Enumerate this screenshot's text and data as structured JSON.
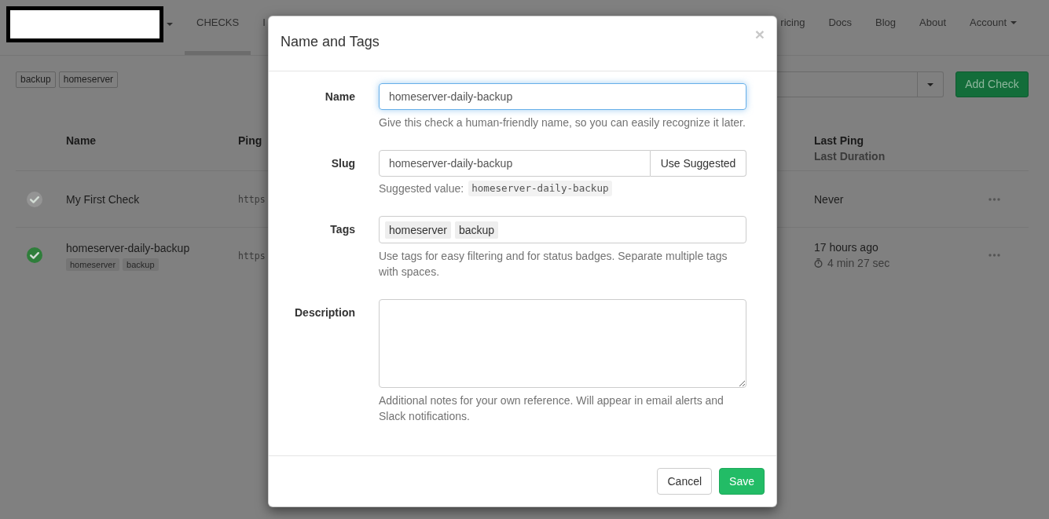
{
  "navbar": {
    "menu": [
      {
        "label": "CHECKS",
        "selected": true
      },
      {
        "label": "I",
        "selected": false
      }
    ],
    "links": [
      {
        "label": "ricing",
        "kind": "link"
      },
      {
        "label": "Docs",
        "kind": "link"
      },
      {
        "label": "Blog",
        "kind": "link"
      },
      {
        "label": "About",
        "kind": "link"
      },
      {
        "label": "Account",
        "kind": "dropdown"
      }
    ]
  },
  "toolbar": {
    "tag_filters": [
      "backup",
      "homeserver"
    ],
    "add_button": "Add Check"
  },
  "table": {
    "columns": [
      {
        "label": "Name"
      },
      {
        "label": "Ping"
      },
      {
        "label": "Last Ping",
        "sublabel": "Last Duration"
      }
    ],
    "rows": [
      {
        "color": "#949494",
        "name": "My First Check",
        "url": "https",
        "last_ping": "Never"
      },
      {
        "color": "#2f7e3b",
        "name": "homeserver-daily-backup",
        "tags": [
          "homeserver",
          "backup"
        ],
        "url": "https",
        "last_ping": "17 hours ago",
        "duration": "4 min 27 sec"
      }
    ]
  },
  "modal": {
    "title": "Name and Tags",
    "close_label": "×",
    "fields": [
      {
        "kind": "input",
        "label": "Name",
        "value": "homeserver-daily-backup",
        "focused": true,
        "help": "Give this check a human-friendly name, so you can easily recognize it later."
      },
      {
        "kind": "input_button",
        "label": "Slug",
        "value": "homeserver-daily-backup",
        "focused": false,
        "button": "Use Suggested",
        "help": "Suggested value:",
        "help_code": "homeserver-daily-backup"
      },
      {
        "kind": "tags",
        "label": "Tags",
        "tags": [
          "homeserver",
          "backup"
        ],
        "help": "Use tags for easy filtering and for status badges. Separate multiple tags with spaces."
      },
      {
        "kind": "textarea",
        "label": "Description",
        "help": "Additional notes for your own reference. Will appear in email alerts and Slack notifications."
      }
    ],
    "buttons": [
      {
        "label": "Cancel",
        "kind": "default"
      },
      {
        "label": "Save",
        "kind": "primary"
      }
    ]
  }
}
